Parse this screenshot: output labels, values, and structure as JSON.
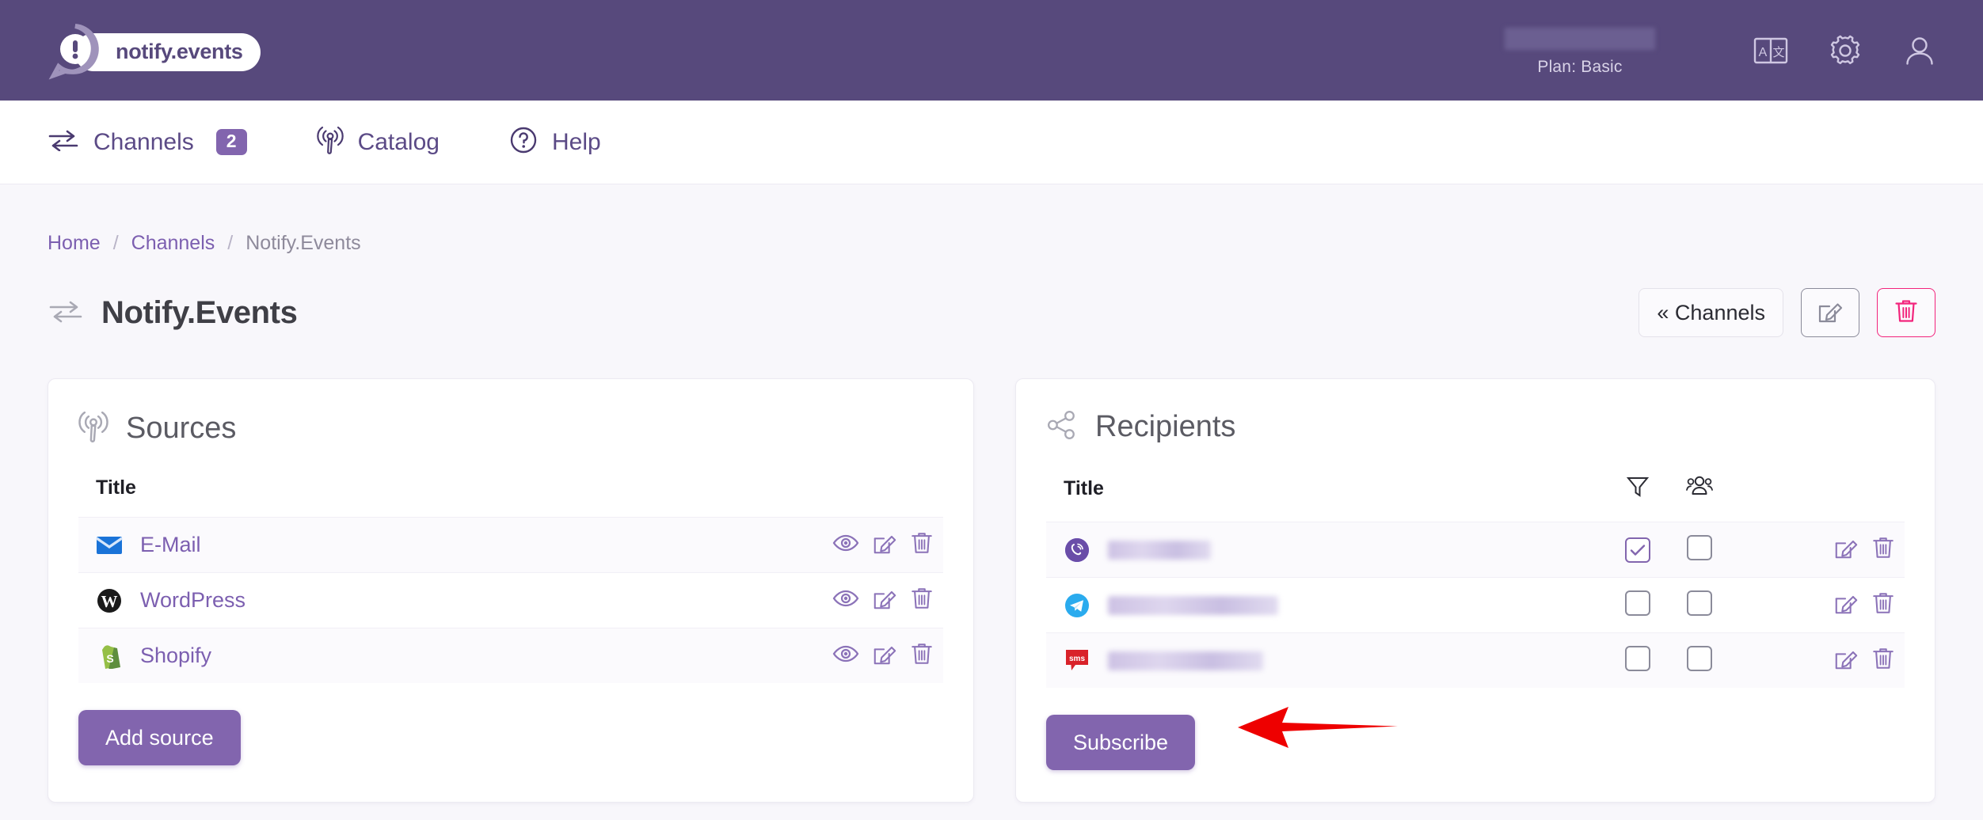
{
  "header": {
    "logo_text": "notify.events",
    "logo_icon": "speech-bubble-exclamation-icon",
    "account_name_redacted": true,
    "plan_label": "Plan: Basic",
    "icons": [
      "translate-icon",
      "gear-icon",
      "user-icon"
    ]
  },
  "nav": {
    "items": [
      {
        "label": "Channels",
        "icon": "exchange-arrows-icon",
        "badge": "2"
      },
      {
        "label": "Catalog",
        "icon": "broadcast-icon",
        "badge": ""
      },
      {
        "label": "Help",
        "icon": "question-circle-icon",
        "badge": ""
      }
    ]
  },
  "breadcrumb": {
    "home": "Home",
    "sep1": "/",
    "channels": "Channels",
    "sep2": "/",
    "current": "Notify.Events"
  },
  "page": {
    "title": "Notify.Events",
    "title_icon": "exchange-arrows-icon",
    "actions": {
      "back_label": "« Channels",
      "edit_icon": "edit-pencil-icon",
      "delete_icon": "trash-icon"
    }
  },
  "sources": {
    "title": "Sources",
    "icon": "broadcast-icon",
    "column_title": "Title",
    "rows": [
      {
        "name": "E-Mail",
        "icon": "email-envelope-icon"
      },
      {
        "name": "WordPress",
        "icon": "wordpress-icon"
      },
      {
        "name": "Shopify",
        "icon": "shopify-icon"
      }
    ],
    "row_actions": [
      "eye-icon",
      "edit-pencil-icon",
      "trash-icon"
    ],
    "add_button": "Add source"
  },
  "recipients": {
    "title": "Recipients",
    "icon": "share-network-icon",
    "column_title": "Title",
    "column_filter_icon": "filter-funnel-icon",
    "column_group_icon": "people-group-icon",
    "rows": [
      {
        "icon": "viber-icon",
        "title_redacted": true,
        "title_width": 92,
        "filter_checked": true,
        "group_checked": false
      },
      {
        "icon": "telegram-icon",
        "title_redacted": true,
        "title_width": 154,
        "filter_checked": false,
        "group_checked": false
      },
      {
        "icon": "sms-icon",
        "title_redacted": true,
        "title_width": 140,
        "filter_checked": false,
        "group_checked": false
      }
    ],
    "row_actions": [
      "edit-pencil-icon",
      "trash-icon"
    ],
    "subscribe_button": "Subscribe",
    "annotation_arrow": "red-arrow-pointing-left"
  },
  "colors": {
    "header_purple": "#57497c",
    "accent_purple": "#8265ae",
    "link_purple": "#7c5fb0",
    "delete_pink": "#f2247c",
    "annotation_red": "#ee0000",
    "page_bg": "#f8f7fb"
  }
}
